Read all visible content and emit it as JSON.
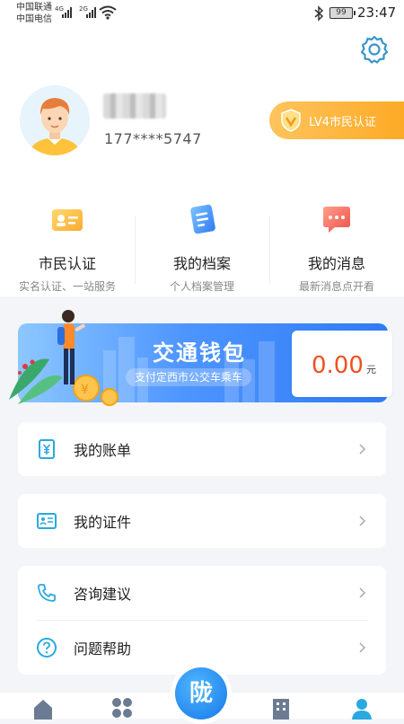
{
  "status_bar": {
    "carrier_1": "中国联通",
    "carrier_2": "中国电信",
    "net_1": "4G",
    "net_2": "2G",
    "battery": "99",
    "time": "23:47"
  },
  "profile": {
    "phone": "177****5747",
    "level_badge": "LV4市民认证"
  },
  "quick_actions": [
    {
      "title": "市民认证",
      "subtitle": "实名认证、一站服务",
      "icon": "id-card-icon"
    },
    {
      "title": "我的档案",
      "subtitle": "个人档案管理",
      "icon": "document-icon"
    },
    {
      "title": "我的消息",
      "subtitle": "最新消息点开看",
      "icon": "message-icon"
    }
  ],
  "wallet": {
    "title": "交通钱包",
    "subtitle": "支付定西市公交车乘车",
    "amount": "0.00",
    "unit": "元"
  },
  "menu": {
    "bill": "我的账单",
    "certificates": "我的证件",
    "consult": "咨询建议",
    "help": "问题帮助"
  },
  "tabbar": {
    "center_glyph": "陇"
  },
  "colors": {
    "accent": "#2aa8e0",
    "badge": "#fdaa26",
    "wallet_amount": "#f0501f"
  }
}
